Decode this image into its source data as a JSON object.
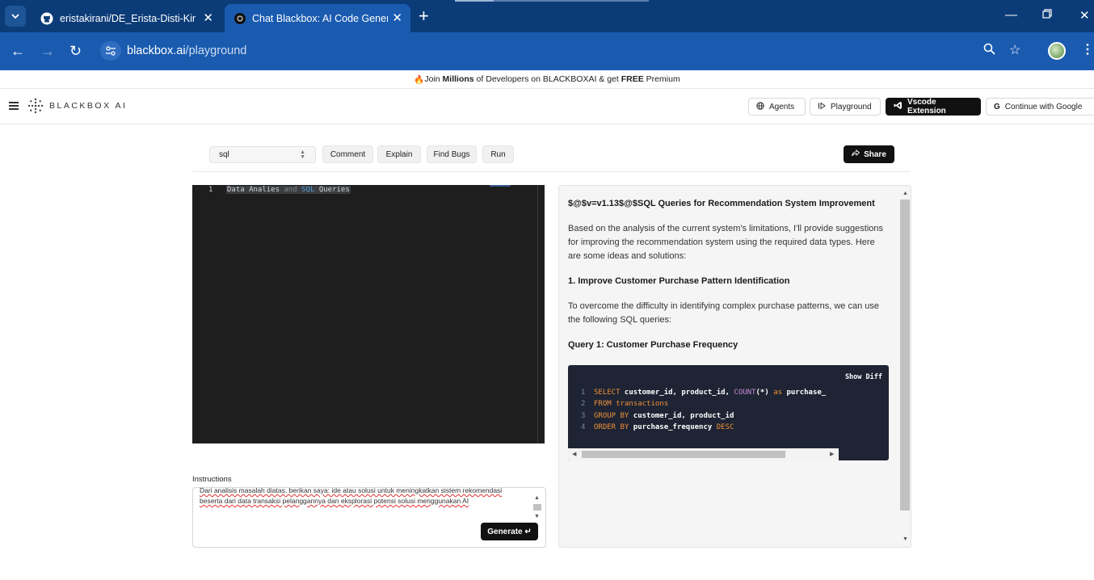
{
  "browser": {
    "tabs": [
      {
        "title": "eristakirani/DE_Erista-Disti-Kiran",
        "active": false
      },
      {
        "title": "Chat Blackbox: AI Code Generat",
        "active": true
      }
    ],
    "url_domain": "blackbox.ai",
    "url_path": "/playground"
  },
  "promo": {
    "emoji": "🔥",
    "pre": "Join ",
    "bold1": "Millions",
    "mid": " of Developers on BLACKBOXAI & get ",
    "bold2": "FREE",
    "post": " Premium"
  },
  "header": {
    "logo": "BLACKBOX AI",
    "agents": "Agents",
    "playground": "Playground",
    "vscode": "Vscode Extension",
    "google": "Continue with Google"
  },
  "toolbar": {
    "language": "sql",
    "comment": "Comment",
    "explain": "Explain",
    "find_bugs": "Find Bugs",
    "run": "Run",
    "share": "Share"
  },
  "editor": {
    "line_number": "1",
    "code_part1": "Data Analies ",
    "code_part2": "and",
    "code_part3": " SQL",
    "code_part4": " Queries"
  },
  "instructions": {
    "label": "Instructions",
    "text": "Dari analisis masalah diatas, berikan saya: ide atau solusi untuk meningkatkan sistem rekomendasi beserta dari data transaksi pelanggannya dan eksplorasi potensi solusi menggunakan AI",
    "generate": "Generate ↵"
  },
  "output": {
    "title": "$@$v=v1.13$@$SQL Queries for Recommendation System Improvement",
    "intro": "Based on the analysis of the current system's limitations, I'll provide suggestions for improving the recommendation system using the required data types. Here are some ideas and solutions:",
    "section1": "1. Improve Customer Purchase Pattern Identification",
    "section1_text": "To overcome the difficulty in identifying complex purchase patterns, we can use the following SQL queries:",
    "query1_title": "Query 1: Customer Purchase Frequency",
    "show_diff": "Show Diff",
    "code_lines": [
      {
        "n": "1",
        "k1": "SELECT",
        "t1": " customer_id, product_id, ",
        "f": "COUNT",
        "t2": "(*) ",
        "k2": "as",
        "t3": " purchase_"
      },
      {
        "n": "2",
        "k1": "FROM",
        "t1": " transactions"
      },
      {
        "n": "3",
        "k1": "GROUP BY",
        "t1": " customer_id, product_id"
      },
      {
        "n": "4",
        "k1": "ORDER BY",
        "t1": " purchase_frequency ",
        "k2": "DESC"
      }
    ]
  }
}
